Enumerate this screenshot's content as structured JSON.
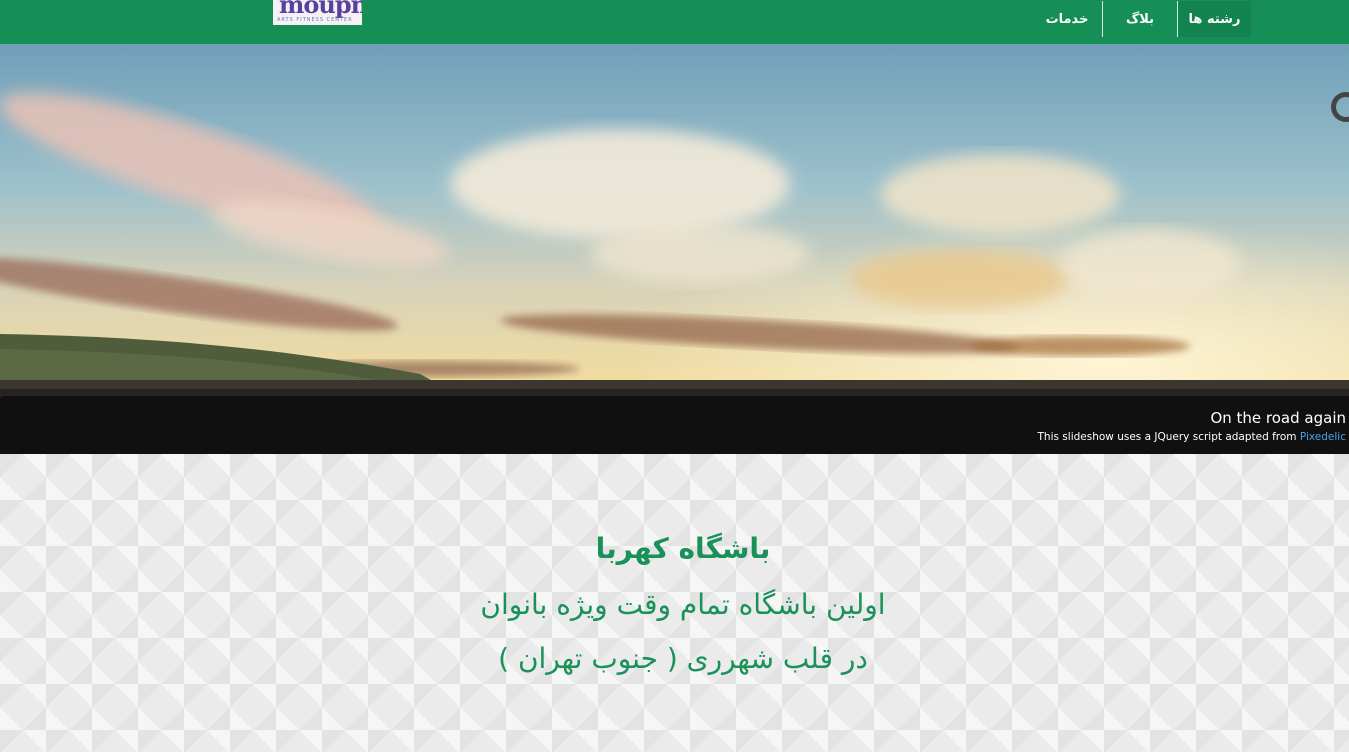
{
  "logo": {
    "word": "moupn",
    "sub": "ARTS FITNESS CENTER"
  },
  "nav": {
    "fields": "رشته ها",
    "blog": "بلاگ",
    "services": "خدمات"
  },
  "slide": {
    "title": "On the road again",
    "subtitle_prefix": "This slideshow uses a JQuery script adapted from",
    "subtitle_link": "Pixedelic"
  },
  "hero": {
    "title": "باشگاه کهربا",
    "line1": "اولین باشگاه تمام وقت ویژه بانوان",
    "line2": "در قلب شهرری ( جنوب تهران )"
  },
  "colors": {
    "brand_green": "#168f56",
    "text_green": "#1a9158",
    "link_blue": "#4ea0e0"
  }
}
